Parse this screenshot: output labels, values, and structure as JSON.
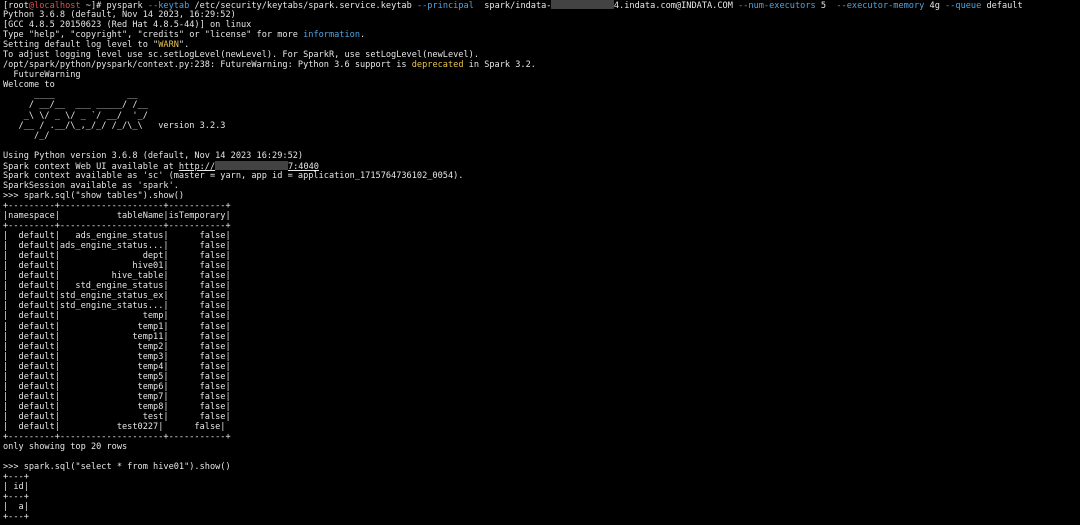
{
  "colors": {
    "background": "#000000",
    "text": "#e6e6e6",
    "red": "#e0524d",
    "blue": "#4fa3e0",
    "yellow": "#e6c44a"
  },
  "lines": [
    {
      "segments": [
        {
          "text": "[root"
        },
        {
          "text": "@localhost",
          "color": "red"
        },
        {
          "text": " ~]# pyspark "
        },
        {
          "text": "--keytab",
          "color": "blue"
        },
        {
          "text": " /etc/security/keytabs/spark.service.keytab "
        },
        {
          "text": "--principal",
          "color": "blue"
        },
        {
          "text": "  spark/indata-"
        },
        {
          "redact": 12
        },
        {
          "text": "4.indata.com@INDATA.COM "
        },
        {
          "text": "--num-executors",
          "color": "blue"
        },
        {
          "text": " 5  "
        },
        {
          "text": "--executor-memory",
          "color": "blue"
        },
        {
          "text": " 4g "
        },
        {
          "text": "--queue",
          "color": "blue"
        },
        {
          "text": " default"
        }
      ]
    },
    {
      "segments": [
        {
          "text": "Python 3.6.8 (default, Nov 14 2023, 16:29:52)"
        }
      ]
    },
    {
      "segments": [
        {
          "text": "[GCC 4.8.5 20150623 (Red Hat 4.8.5-44)] on linux"
        }
      ]
    },
    {
      "segments": [
        {
          "text": "Type \"help\", \"copyright\", \"credits\" or \"license\" for more "
        },
        {
          "text": "information",
          "color": "blue"
        },
        {
          "text": "."
        }
      ]
    },
    {
      "segments": [
        {
          "text": "Setting default log level to \""
        },
        {
          "text": "WARN",
          "color": "yellow"
        },
        {
          "text": "\"."
        }
      ]
    },
    {
      "segments": [
        {
          "text": "To adjust logging level use sc.setLogLevel(newLevel). For SparkR, use setLogLevel(newLevel)."
        }
      ]
    },
    {
      "segments": [
        {
          "text": "/opt/spark/python/pyspark/context.py:238: FutureWarning: Python 3.6 support is "
        },
        {
          "text": "deprecated",
          "color": "yellow"
        },
        {
          "text": " in Spark 3.2."
        }
      ]
    },
    {
      "segments": [
        {
          "text": "  FutureWarning"
        }
      ]
    },
    {
      "segments": [
        {
          "text": "Welcome to"
        }
      ]
    },
    {
      "segments": [
        {
          "text": "      ____              __"
        }
      ]
    },
    {
      "segments": [
        {
          "text": "     / __/__  ___ _____/ /__"
        }
      ]
    },
    {
      "segments": [
        {
          "text": "    _\\ \\/ _ \\/ _ `/ __/  '_/"
        }
      ]
    },
    {
      "segments": [
        {
          "text": "   /__ / .__/\\_,_/_/ /_/\\_\\   version 3.2.3"
        }
      ]
    },
    {
      "segments": [
        {
          "text": "      /_/"
        }
      ]
    },
    {
      "segments": [
        {
          "text": ""
        }
      ]
    },
    {
      "segments": [
        {
          "text": "Using Python version 3.6.8 (default, Nov 14 2023 16:29:52)"
        }
      ]
    },
    {
      "segments": [
        {
          "text": "Spark context Web UI available at "
        },
        {
          "text": "http://",
          "underline": true
        },
        {
          "redact": 14
        },
        {
          "text": "7:4040",
          "underline": true
        }
      ]
    },
    {
      "segments": [
        {
          "text": "Spark context available as 'sc' (master = yarn, app id = application_1715764736102_0054)."
        }
      ]
    },
    {
      "segments": [
        {
          "text": "SparkSession available as 'spark'."
        }
      ]
    },
    {
      "segments": [
        {
          "text": ">>> spark.sql(\"show tables\").show()"
        }
      ]
    },
    {
      "segments": [
        {
          "text": "+---------+--------------------+-----------+"
        }
      ]
    },
    {
      "segments": [
        {
          "text": "|namespace|           tableName|isTemporary|"
        }
      ]
    },
    {
      "segments": [
        {
          "text": "+---------+--------------------+-----------+"
        }
      ]
    },
    {
      "segments": [
        {
          "text": "|  default|   ads_engine_status|      false|"
        }
      ]
    },
    {
      "segments": [
        {
          "text": "|  default|ads_engine_status...|      false|"
        }
      ]
    },
    {
      "segments": [
        {
          "text": "|  default|                dept|      false|"
        }
      ]
    },
    {
      "segments": [
        {
          "text": "|  default|              hive01|      false|"
        }
      ]
    },
    {
      "segments": [
        {
          "text": "|  default|          hive_table|      false|"
        }
      ]
    },
    {
      "segments": [
        {
          "text": "|  default|   std_engine_status|      false|"
        }
      ]
    },
    {
      "segments": [
        {
          "text": "|  default|std_engine_status_ex|      false|"
        }
      ]
    },
    {
      "segments": [
        {
          "text": "|  default|std_engine_status...|      false|"
        }
      ]
    },
    {
      "segments": [
        {
          "text": "|  default|                temp|      false|"
        }
      ]
    },
    {
      "segments": [
        {
          "text": "|  default|               temp1|      false|"
        }
      ]
    },
    {
      "segments": [
        {
          "text": "|  default|              temp11|      false|"
        }
      ]
    },
    {
      "segments": [
        {
          "text": "|  default|               temp2|      false|"
        }
      ]
    },
    {
      "segments": [
        {
          "text": "|  default|               temp3|      false|"
        }
      ]
    },
    {
      "segments": [
        {
          "text": "|  default|               temp4|      false|"
        }
      ]
    },
    {
      "segments": [
        {
          "text": "|  default|               temp5|      false|"
        }
      ]
    },
    {
      "segments": [
        {
          "text": "|  default|               temp6|      false|"
        }
      ]
    },
    {
      "segments": [
        {
          "text": "|  default|               temp7|      false|"
        }
      ]
    },
    {
      "segments": [
        {
          "text": "|  default|               temp8|      false|"
        }
      ]
    },
    {
      "segments": [
        {
          "text": "|  default|                test|      false|"
        }
      ]
    },
    {
      "segments": [
        {
          "text": "|  default|           test0227|      false|"
        }
      ]
    },
    {
      "segments": [
        {
          "text": "+---------+--------------------+-----------+"
        }
      ]
    },
    {
      "segments": [
        {
          "text": "only showing top 20 rows"
        }
      ]
    },
    {
      "segments": [
        {
          "text": ""
        }
      ]
    },
    {
      "segments": [
        {
          "text": ">>> spark.sql(\"select * from hive01\").show()"
        }
      ]
    },
    {
      "segments": [
        {
          "text": "+---+"
        }
      ]
    },
    {
      "segments": [
        {
          "text": "| id|"
        }
      ]
    },
    {
      "segments": [
        {
          "text": "+---+"
        }
      ]
    },
    {
      "segments": [
        {
          "text": "|  a|"
        }
      ]
    },
    {
      "segments": [
        {
          "text": "+---+"
        }
      ]
    }
  ]
}
